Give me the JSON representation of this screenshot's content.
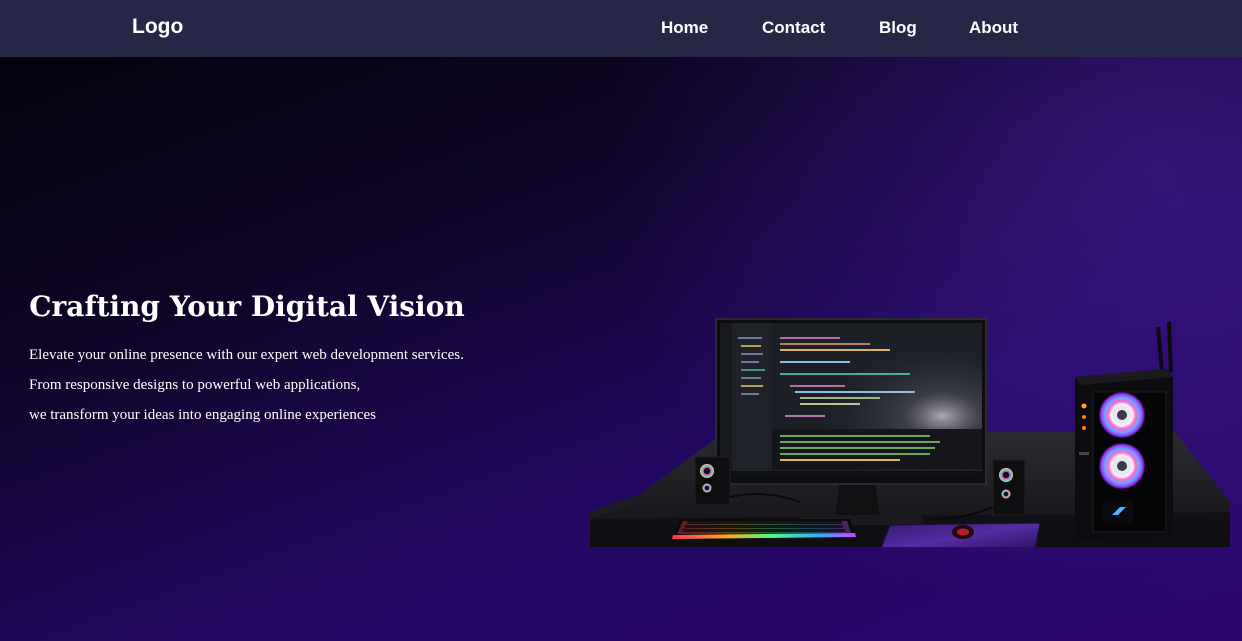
{
  "nav": {
    "logo": "Logo",
    "links": [
      {
        "label": "Home"
      },
      {
        "label": "Contact"
      },
      {
        "label": "Blog"
      },
      {
        "label": "About"
      }
    ]
  },
  "hero": {
    "title": "Crafting Your Digital Vision",
    "lines": [
      "Elevate your online presence with our expert web development services.",
      "From responsive designs to powerful web applications,",
      "we transform your ideas into engaging online experiences"
    ],
    "illustration": "gaming-desk-setup-3d"
  },
  "colors": {
    "navbar": "#262746",
    "hero_dark": "#05020f",
    "hero_purple": "#2d066e",
    "text": "#ffffff"
  }
}
